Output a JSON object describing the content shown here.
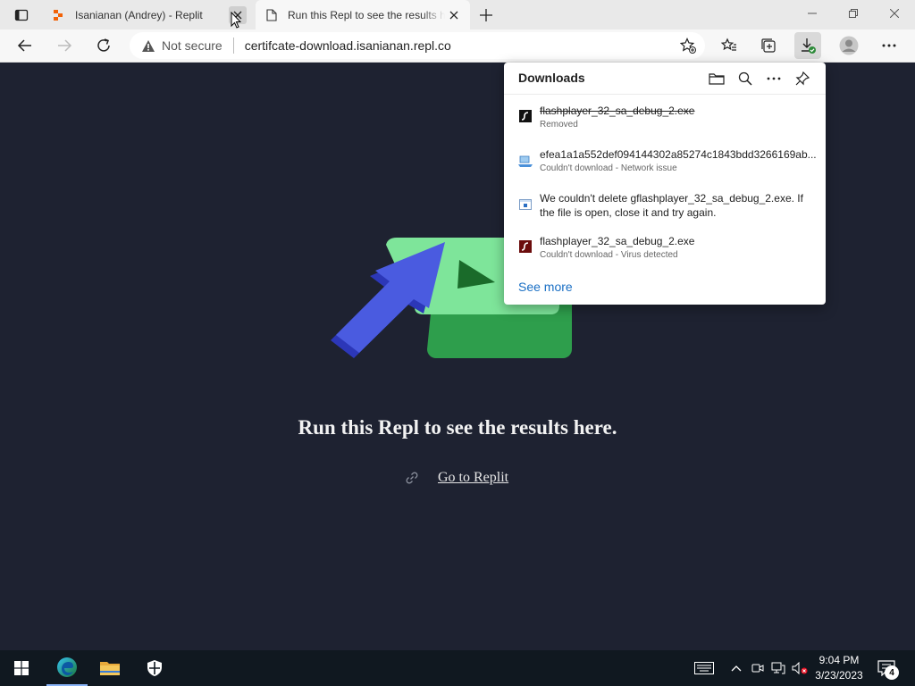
{
  "browser": {
    "tabs": [
      {
        "title": "Isanianan (Andrey) - Replit",
        "favicon": "replit-icon"
      },
      {
        "title": "Run this Repl to see the results here.",
        "favicon": "page-icon"
      }
    ],
    "address_bar": {
      "security_label": "Not secure",
      "url": "certifcate-download.isanianan.repl.co"
    }
  },
  "downloads": {
    "title": "Downloads",
    "items": [
      {
        "name": "flashplayer_32_sa_debug_2.exe",
        "status": "Removed",
        "icon": "flash-icon",
        "struck": true
      },
      {
        "name": "efea1a1a552def094144302a85274c1843bdd3266169ab...",
        "status": "Couldn't download - Network issue",
        "icon": "installer-icon"
      },
      {
        "message": "We couldn't delete gflashplayer_32_sa_debug_2.exe. If the file is open, close it and try again.",
        "icon": "info-window-icon"
      },
      {
        "name": "flashplayer_32_sa_debug_2.exe",
        "status": "Couldn't download - Virus detected",
        "icon": "flash-icon"
      }
    ],
    "see_more": "See more"
  },
  "page": {
    "headline": "Run this Repl to see the results here.",
    "link": "Go to Replit"
  },
  "taskbar": {
    "time": "9:04 PM",
    "date": "3/23/2023",
    "notification_count": "4"
  },
  "colors": {
    "page_bg": "#1e2231",
    "hero_green": "#6fe08a",
    "hero_arrow": "#4a5be0",
    "link_blue": "#1a6fc4"
  }
}
